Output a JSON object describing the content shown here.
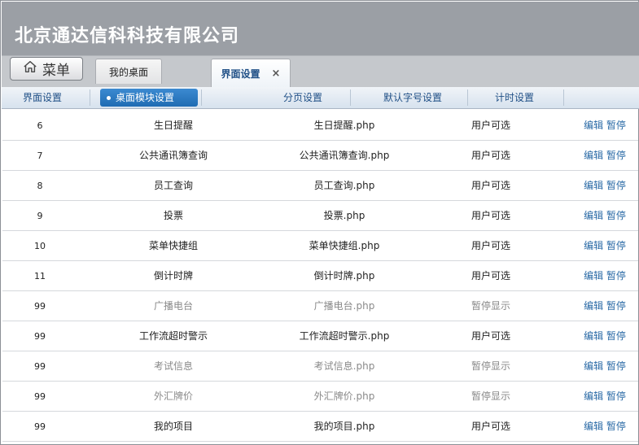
{
  "company": "北京通达信科科技有限公司",
  "menu_button": "菜单",
  "tabs": [
    {
      "label": "我的桌面"
    },
    {
      "label": "界面设置",
      "close": "×"
    }
  ],
  "subnav": {
    "items": [
      "界面设置",
      "桌面模块设置",
      "分页设置",
      "默认字号设置",
      "计时设置"
    ],
    "active_index": 1
  },
  "actions": {
    "edit": "编辑",
    "pause": "暂停"
  },
  "rows": [
    {
      "no": "6",
      "name": "生日提醒",
      "file": "生日提醒.php",
      "status": "用户可选"
    },
    {
      "no": "7",
      "name": "公共通讯簿查询",
      "file": "公共通讯簿查询.php",
      "status": "用户可选"
    },
    {
      "no": "8",
      "name": "员工查询",
      "file": "员工查询.php",
      "status": "用户可选"
    },
    {
      "no": "9",
      "name": "投票",
      "file": "投票.php",
      "status": "用户可选"
    },
    {
      "no": "10",
      "name": "菜单快捷组",
      "file": "菜单快捷组.php",
      "status": "用户可选"
    },
    {
      "no": "11",
      "name": "倒计时牌",
      "file": "倒计时牌.php",
      "status": "用户可选"
    },
    {
      "no": "99",
      "name": "广播电台",
      "file": "广播电台.php",
      "status": "暂停显示"
    },
    {
      "no": "99",
      "name": "工作流超时警示",
      "file": "工作流超时警示.php",
      "status": "用户可选"
    },
    {
      "no": "99",
      "name": "考试信息",
      "file": "考试信息.php",
      "status": "暂停显示"
    },
    {
      "no": "99",
      "name": "外汇牌价",
      "file": "外汇牌价.php",
      "status": "暂停显示"
    },
    {
      "no": "99",
      "name": "我的项目",
      "file": "我的项目.php",
      "status": "用户可选"
    }
  ]
}
